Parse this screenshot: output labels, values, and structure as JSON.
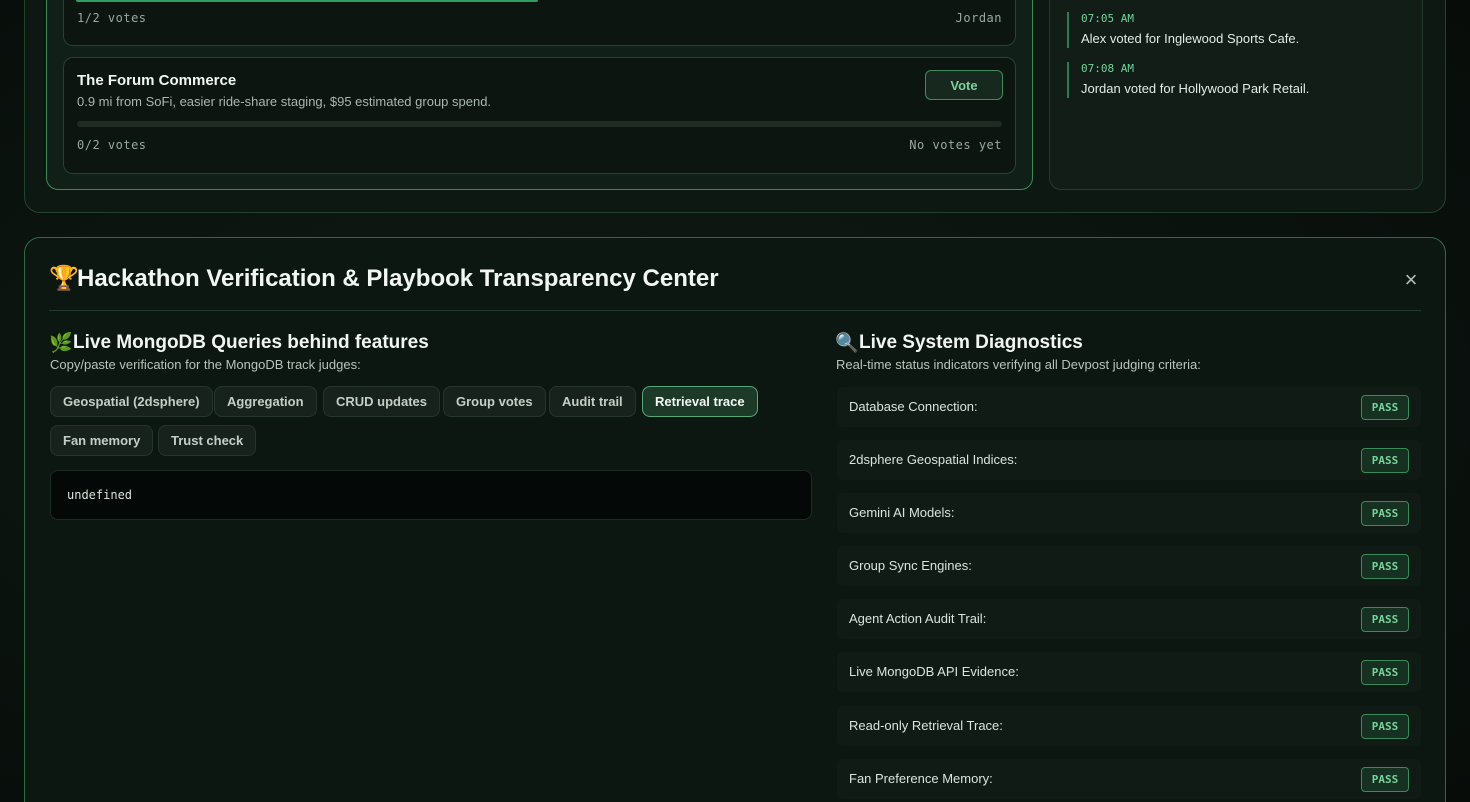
{
  "poll": {
    "options": [
      {
        "title": "",
        "desc": "",
        "votes_text": "1/2 votes",
        "voters": "Jordan",
        "progress": 0.5
      },
      {
        "title": "The Forum Commerce",
        "desc": "0.9 mi from SoFi, easier ride-share staging, $95 estimated group spend.",
        "votes_text": "0/2 votes",
        "voters": "No votes yet",
        "vote_label": "Vote",
        "progress": 0
      }
    ]
  },
  "activity": [
    {
      "time": "07:05 AM",
      "text": "Alex voted for Inglewood Sports Cafe."
    },
    {
      "time": "07:08 AM",
      "text": "Jordan voted for Hollywood Park Retail."
    }
  ],
  "verification": {
    "title_icon": "🏆",
    "title": "Hackathon Verification & Playbook Transparency Center",
    "close_label": "×",
    "queries": {
      "icon": "🌿",
      "title": "Live MongoDB Queries behind features",
      "subtitle": "Copy/paste verification for the MongoDB track judges:",
      "tabs": [
        {
          "label": "Geospatial (2dsphere)",
          "active": false
        },
        {
          "label": "Aggregation",
          "active": false
        },
        {
          "label": "CRUD updates",
          "active": false
        },
        {
          "label": "Group votes",
          "active": false
        },
        {
          "label": "Audit trail",
          "active": false
        },
        {
          "label": "Retrieval trace",
          "active": true
        },
        {
          "label": "Fan memory",
          "active": false
        },
        {
          "label": "Trust check",
          "active": false
        }
      ],
      "code": "undefined"
    },
    "diagnostics": {
      "icon": "🔍",
      "title": "Live System Diagnostics",
      "subtitle": "Real-time status indicators verifying all Devpost judging criteria:",
      "rows": [
        {
          "label": "Database Connection:",
          "status": "PASS"
        },
        {
          "label": "2dsphere Geospatial Indices:",
          "status": "PASS"
        },
        {
          "label": "Gemini AI Models:",
          "status": "PASS"
        },
        {
          "label": "Group Sync Engines:",
          "status": "PASS"
        },
        {
          "label": "Agent Action Audit Trail:",
          "status": "PASS"
        },
        {
          "label": "Live MongoDB API Evidence:",
          "status": "PASS"
        },
        {
          "label": "Read-only Retrieval Trace:",
          "status": "PASS"
        },
        {
          "label": "Fan Preference Memory:",
          "status": "PASS"
        }
      ]
    }
  },
  "colors": {
    "accent": "#2e9e63",
    "pass": "#76d49b",
    "bg": "#0a110d"
  }
}
